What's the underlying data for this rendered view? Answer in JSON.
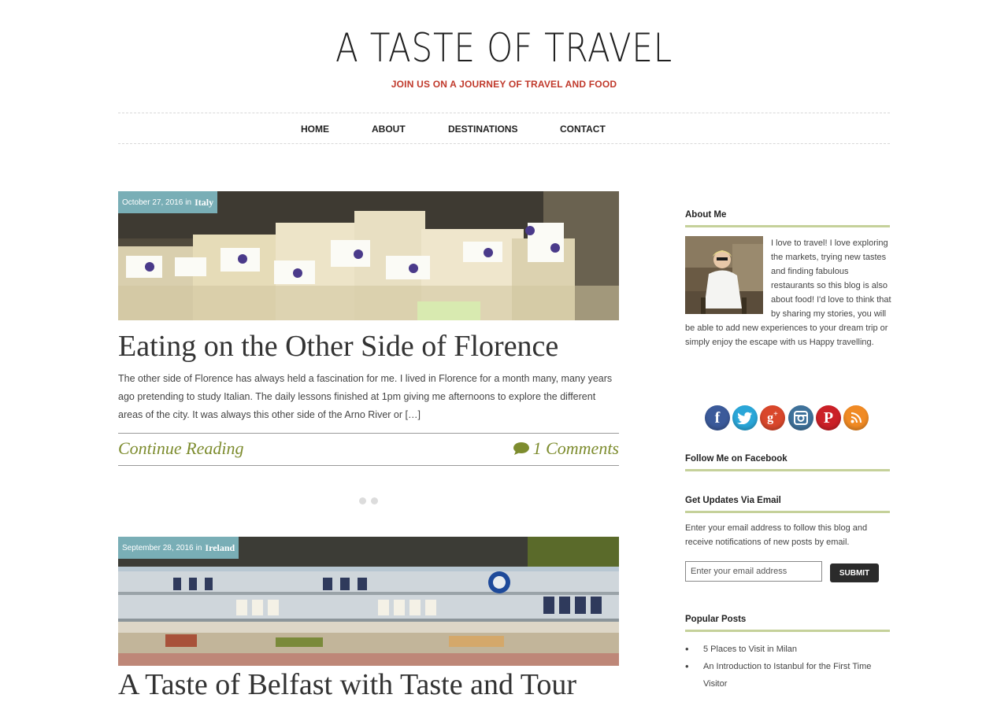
{
  "site": {
    "title": "A TASTE OF TRAVEL",
    "tagline": "JOIN US ON A JOURNEY OF TRAVEL AND FOOD"
  },
  "nav": {
    "items": [
      "HOME",
      "ABOUT",
      "DESTINATIONS",
      "CONTACT"
    ]
  },
  "posts": [
    {
      "date": "October 27, 2016",
      "in": "in",
      "category": "Italy",
      "title": "Eating on the Other Side of Florence",
      "excerpt": "The other side of Florence has always held a fascination for me. I lived in Florence for a month many, many years ago pretending to study Italian. The daily lessons finished at 1pm giving me afternoons to explore the different areas of the city. It was always this other side of the Arno River or […]",
      "continue": "Continue Reading",
      "comments": "1 Comments"
    },
    {
      "date": "September 28, 2016",
      "in": "in",
      "category": "Ireland",
      "title": "A Taste of Belfast with Taste and Tour"
    }
  ],
  "sidebar": {
    "about_heading": "About Me",
    "about_text": "I love to travel! I love exploring the markets, trying new tastes and finding fabulous restaurants so this blog is also about food! I'd love to think that by sharing my stories, you will be able to add new experiences to your dream trip or simply enjoy the escape with us Happy travelling.",
    "social_icons": [
      "facebook-icon",
      "twitter-icon",
      "google-plus-icon",
      "instagram-icon",
      "pinterest-icon",
      "rss-icon"
    ],
    "facebook_heading": "Follow Me on Facebook",
    "email_heading": "Get Updates Via Email",
    "email_desc": "Enter your email address to follow this blog and receive notifications of new posts by email.",
    "email_placeholder": "Enter your email address",
    "submit_label": "SUBMIT",
    "popular_heading": "Popular Posts",
    "popular_posts": [
      "5 Places to Visit in Milan",
      "An Introduction to Istanbul for the First Time Visitor"
    ]
  },
  "colors": {
    "tagline": "#c0392b",
    "accent_link": "#7d8c2e",
    "meta_bg": "#82bec8",
    "heading_rule": "#c5d19a"
  }
}
